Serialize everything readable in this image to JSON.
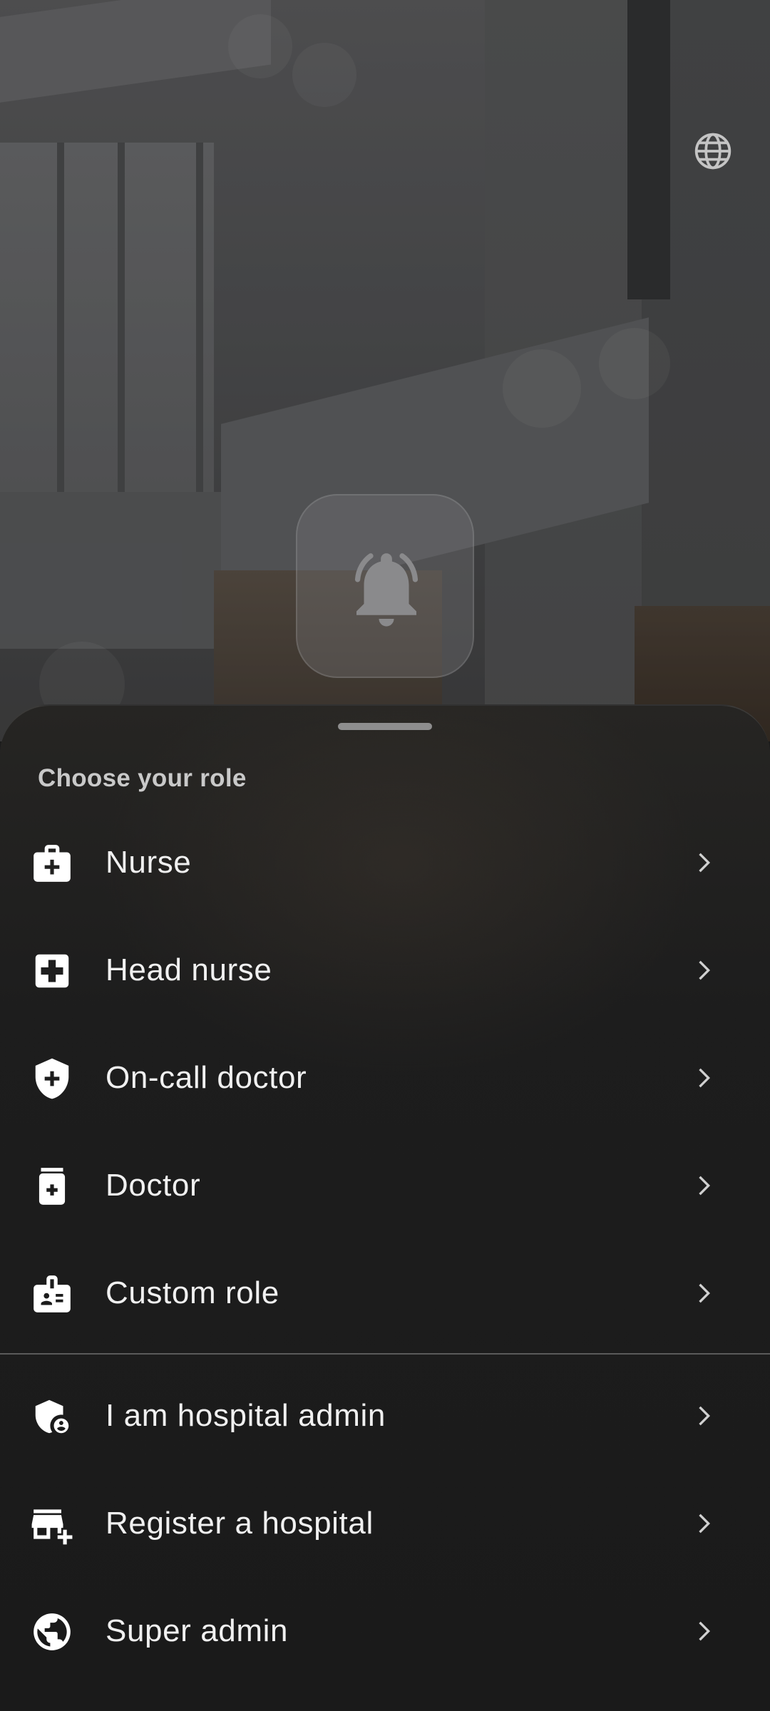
{
  "header": {
    "language_icon": "globe-icon",
    "app_logo_icon": "bell-alarm-icon"
  },
  "sheet": {
    "title": "Choose your role",
    "roles": [
      {
        "label": "Nurse",
        "icon": "medical-bag-icon"
      },
      {
        "label": "Head nurse",
        "icon": "medical-cross-square-icon"
      },
      {
        "label": "On-call doctor",
        "icon": "shield-cross-icon"
      },
      {
        "label": "Doctor",
        "icon": "medication-bottle-icon"
      },
      {
        "label": "Custom role",
        "icon": "id-badge-icon"
      }
    ],
    "admin_options": [
      {
        "label": "I am hospital admin",
        "icon": "admin-shield-icon"
      },
      {
        "label": "Register a hospital",
        "icon": "add-business-icon"
      },
      {
        "label": "Super admin",
        "icon": "public-globe-icon"
      }
    ],
    "chevron_icon": "chevron-right-icon"
  },
  "colors": {
    "sheet_background": "#1b1b1b",
    "text_primary": "#f0f0f0",
    "text_title": "#c9c9c9",
    "divider": "#5a5a5a"
  }
}
